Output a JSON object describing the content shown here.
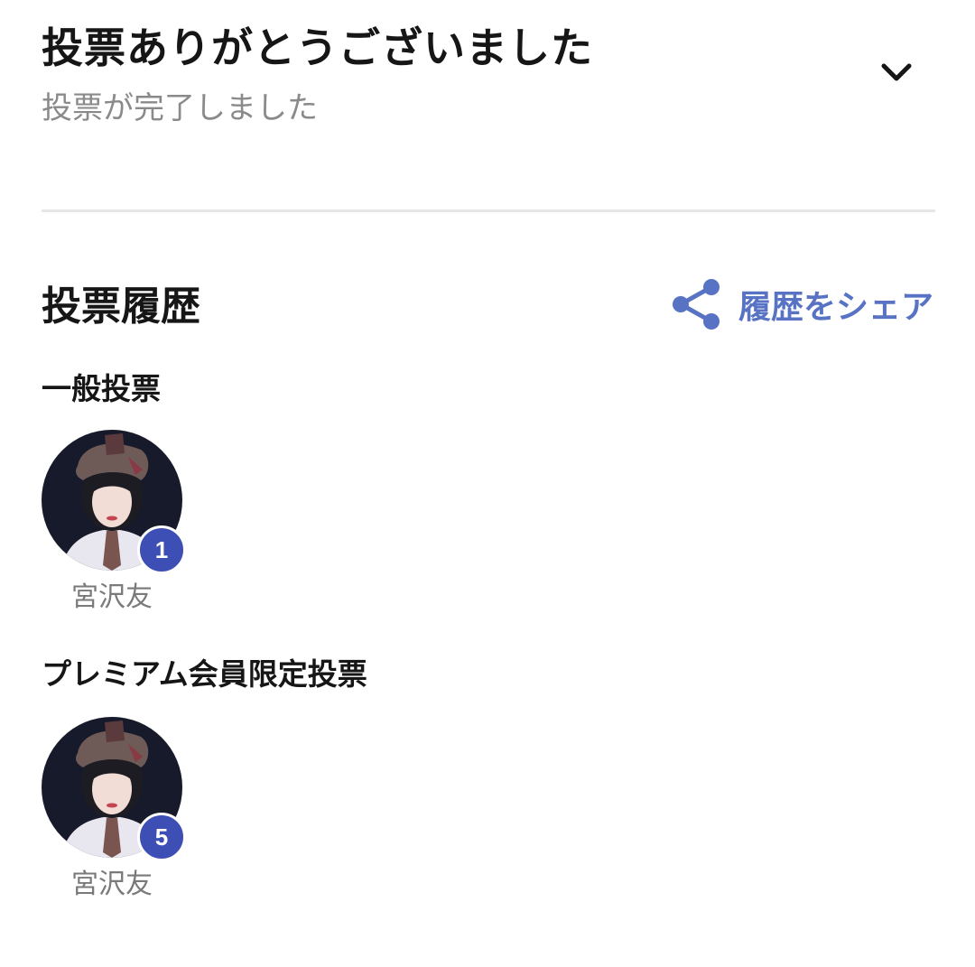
{
  "header": {
    "title": "投票ありがとうございました",
    "subtitle": "投票が完了しました",
    "collapse_icon": "chevron-down-icon"
  },
  "history": {
    "title": "投票履歴",
    "share_label": "履歴をシェア",
    "share_icon": "share-icon"
  },
  "sections": [
    {
      "label": "一般投票",
      "votes": [
        {
          "name": "宮沢友",
          "count": "1"
        }
      ]
    },
    {
      "label": "プレミアム会員限定投票",
      "votes": [
        {
          "name": "宮沢友",
          "count": "5"
        }
      ]
    }
  ],
  "colors": {
    "accent": "#5872c4",
    "badge": "#3d4fb4",
    "divider": "#e6e6e6"
  }
}
